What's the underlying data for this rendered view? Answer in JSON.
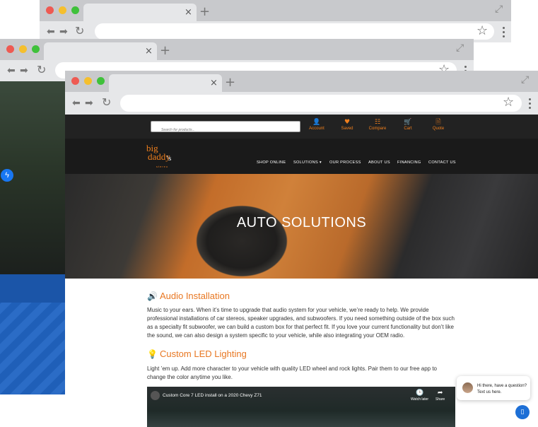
{
  "browser": {
    "close_glyph": "×",
    "new_tab_glyph": "+",
    "expand_glyph": "⤢",
    "back_glyph": "⬅",
    "forward_glyph": "➡",
    "reload_glyph": "↻",
    "star_glyph": "☆"
  },
  "behind_window": {
    "messenger_glyph": "ϟ"
  },
  "site": {
    "search_placeholder": "Search for products...",
    "utility": [
      {
        "icon": "user-icon",
        "glyph": "👤",
        "label": "Account"
      },
      {
        "icon": "heart-icon",
        "glyph": "♥",
        "label": "Saved"
      },
      {
        "icon": "compare-icon",
        "glyph": "☷",
        "label": "Compare"
      },
      {
        "icon": "cart-icon",
        "glyph": "🛒",
        "label": "Cart"
      },
      {
        "icon": "quote-icon",
        "glyph": "🗎",
        "label": "Quote"
      }
    ],
    "logo": {
      "line1": "big",
      "line2": "daddy",
      "line3": "'s",
      "tagline": "stereo"
    },
    "menu": [
      "SHOP ONLINE",
      "SOLUTIONS ▾",
      "OUR PROCESS",
      "ABOUT US",
      "FINANCING",
      "CONTACT US"
    ],
    "hero_title": "AUTO SOLUTIONS",
    "sections": [
      {
        "icon": "speaker-icon",
        "glyph": "🔊",
        "title": "Audio Installation",
        "text": "Music to your ears. When it’s time to upgrade that audio system for your vehicle, we’re ready to help. We provide professional installations of car stereos, speaker upgrades, and subwoofers. If you need something outside of the box such as a specialty fit subwoofer, we can build a custom box for that perfect fit. If you love your current functionality but don’t like the sound, we can also design a system specific to your vehicle, while also integrating your OEM radio."
      },
      {
        "icon": "lightbulb-icon",
        "glyph": "💡",
        "title": "Custom LED Lighting",
        "text": "Light ’em up. Add more character to your vehicle with quality LED wheel and rock lights. Pair them to our free app to change the color anytime you like."
      }
    ],
    "video": {
      "title": "Custom Core 7 LED install on a 2020 Chevy Z71",
      "watch_later_glyph": "🕒",
      "watch_later": "Watch later",
      "share_glyph": "➦",
      "share": "Share"
    },
    "chat": {
      "message": "Hi there, have a question? Text us here.",
      "button_glyph": "▯"
    }
  }
}
